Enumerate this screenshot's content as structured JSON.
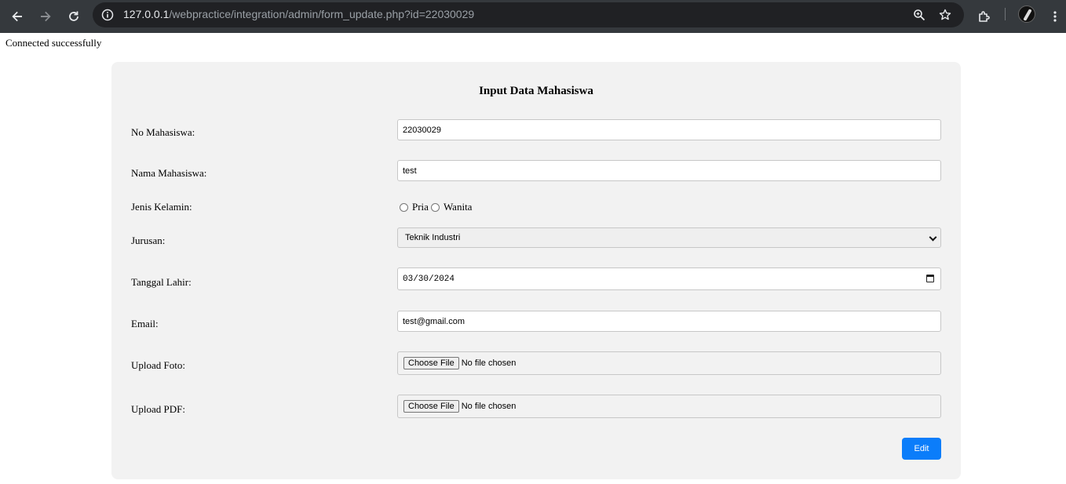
{
  "browser": {
    "url_host": "127.0.0.1",
    "url_path": "/webpractice/integration/admin/form_update.php?id=22030029"
  },
  "page": {
    "status_message": "Connected successfully"
  },
  "form": {
    "title": "Input Data Mahasiswa",
    "no_mahasiswa": {
      "label": "No Mahasiswa:",
      "value": "22030029"
    },
    "nama_mahasiswa": {
      "label": "Nama Mahasiswa:",
      "value": "test"
    },
    "jenis_kelamin": {
      "label": "Jenis Kelamin:",
      "options": [
        "Pria",
        "Wanita"
      ]
    },
    "jurusan": {
      "label": "Jurusan:",
      "selected": "Teknik Industri"
    },
    "tanggal_lahir": {
      "label": "Tanggal Lahir:",
      "value": "03/30/2024"
    },
    "email": {
      "label": "Email:",
      "value": "test@gmail.com"
    },
    "upload_foto": {
      "label": "Upload Foto:",
      "button": "Choose File",
      "status": "No file chosen"
    },
    "upload_pdf": {
      "label": "Upload PDF:",
      "button": "Choose File",
      "status": "No file chosen"
    },
    "submit_label": "Edit"
  }
}
